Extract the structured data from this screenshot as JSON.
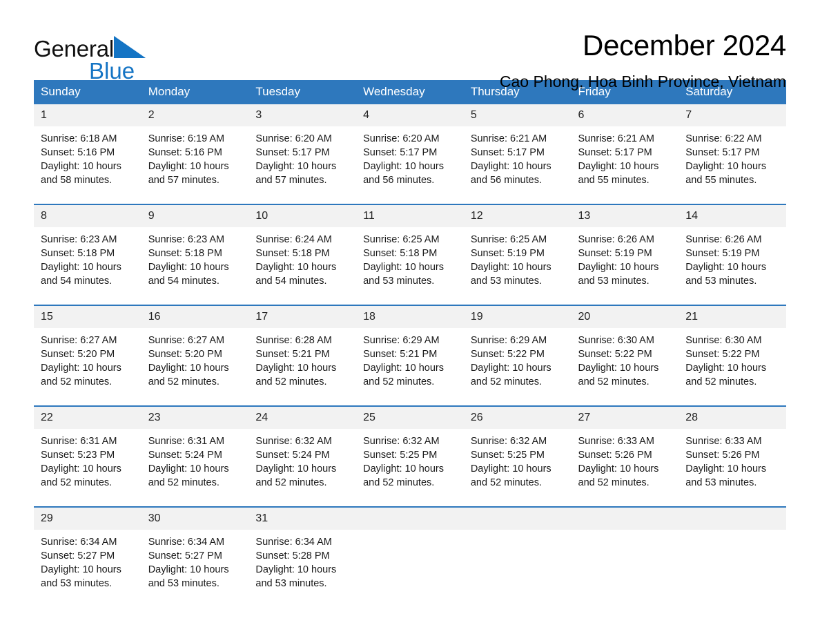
{
  "brand": {
    "word_general": "General",
    "word_blue": "Blue",
    "triangle_color": "#1474c4",
    "blue_text_color": "#1474c4"
  },
  "header": {
    "title": "December 2024",
    "subtitle": "Cao Phong, Hoa Binh Province, Vietnam"
  },
  "theme": {
    "header_blue": "#2e78bd",
    "daynum_gray": "#f2f2f2",
    "row_divider": "#2e78bd"
  },
  "weekdays": [
    "Sunday",
    "Monday",
    "Tuesday",
    "Wednesday",
    "Thursday",
    "Friday",
    "Saturday"
  ],
  "labels": {
    "sunrise_prefix": "Sunrise:",
    "sunset_prefix": "Sunset:",
    "daylight_prefix": "Daylight:"
  },
  "weeks": [
    [
      {
        "day": "1",
        "sunrise": "Sunrise: 6:18 AM",
        "sunset": "Sunset: 5:16 PM",
        "daylight_line1": "Daylight: 10 hours",
        "daylight_line2": "and 58 minutes."
      },
      {
        "day": "2",
        "sunrise": "Sunrise: 6:19 AM",
        "sunset": "Sunset: 5:16 PM",
        "daylight_line1": "Daylight: 10 hours",
        "daylight_line2": "and 57 minutes."
      },
      {
        "day": "3",
        "sunrise": "Sunrise: 6:20 AM",
        "sunset": "Sunset: 5:17 PM",
        "daylight_line1": "Daylight: 10 hours",
        "daylight_line2": "and 57 minutes."
      },
      {
        "day": "4",
        "sunrise": "Sunrise: 6:20 AM",
        "sunset": "Sunset: 5:17 PM",
        "daylight_line1": "Daylight: 10 hours",
        "daylight_line2": "and 56 minutes."
      },
      {
        "day": "5",
        "sunrise": "Sunrise: 6:21 AM",
        "sunset": "Sunset: 5:17 PM",
        "daylight_line1": "Daylight: 10 hours",
        "daylight_line2": "and 56 minutes."
      },
      {
        "day": "6",
        "sunrise": "Sunrise: 6:21 AM",
        "sunset": "Sunset: 5:17 PM",
        "daylight_line1": "Daylight: 10 hours",
        "daylight_line2": "and 55 minutes."
      },
      {
        "day": "7",
        "sunrise": "Sunrise: 6:22 AM",
        "sunset": "Sunset: 5:17 PM",
        "daylight_line1": "Daylight: 10 hours",
        "daylight_line2": "and 55 minutes."
      }
    ],
    [
      {
        "day": "8",
        "sunrise": "Sunrise: 6:23 AM",
        "sunset": "Sunset: 5:18 PM",
        "daylight_line1": "Daylight: 10 hours",
        "daylight_line2": "and 54 minutes."
      },
      {
        "day": "9",
        "sunrise": "Sunrise: 6:23 AM",
        "sunset": "Sunset: 5:18 PM",
        "daylight_line1": "Daylight: 10 hours",
        "daylight_line2": "and 54 minutes."
      },
      {
        "day": "10",
        "sunrise": "Sunrise: 6:24 AM",
        "sunset": "Sunset: 5:18 PM",
        "daylight_line1": "Daylight: 10 hours",
        "daylight_line2": "and 54 minutes."
      },
      {
        "day": "11",
        "sunrise": "Sunrise: 6:25 AM",
        "sunset": "Sunset: 5:18 PM",
        "daylight_line1": "Daylight: 10 hours",
        "daylight_line2": "and 53 minutes."
      },
      {
        "day": "12",
        "sunrise": "Sunrise: 6:25 AM",
        "sunset": "Sunset: 5:19 PM",
        "daylight_line1": "Daylight: 10 hours",
        "daylight_line2": "and 53 minutes."
      },
      {
        "day": "13",
        "sunrise": "Sunrise: 6:26 AM",
        "sunset": "Sunset: 5:19 PM",
        "daylight_line1": "Daylight: 10 hours",
        "daylight_line2": "and 53 minutes."
      },
      {
        "day": "14",
        "sunrise": "Sunrise: 6:26 AM",
        "sunset": "Sunset: 5:19 PM",
        "daylight_line1": "Daylight: 10 hours",
        "daylight_line2": "and 53 minutes."
      }
    ],
    [
      {
        "day": "15",
        "sunrise": "Sunrise: 6:27 AM",
        "sunset": "Sunset: 5:20 PM",
        "daylight_line1": "Daylight: 10 hours",
        "daylight_line2": "and 52 minutes."
      },
      {
        "day": "16",
        "sunrise": "Sunrise: 6:27 AM",
        "sunset": "Sunset: 5:20 PM",
        "daylight_line1": "Daylight: 10 hours",
        "daylight_line2": "and 52 minutes."
      },
      {
        "day": "17",
        "sunrise": "Sunrise: 6:28 AM",
        "sunset": "Sunset: 5:21 PM",
        "daylight_line1": "Daylight: 10 hours",
        "daylight_line2": "and 52 minutes."
      },
      {
        "day": "18",
        "sunrise": "Sunrise: 6:29 AM",
        "sunset": "Sunset: 5:21 PM",
        "daylight_line1": "Daylight: 10 hours",
        "daylight_line2": "and 52 minutes."
      },
      {
        "day": "19",
        "sunrise": "Sunrise: 6:29 AM",
        "sunset": "Sunset: 5:22 PM",
        "daylight_line1": "Daylight: 10 hours",
        "daylight_line2": "and 52 minutes."
      },
      {
        "day": "20",
        "sunrise": "Sunrise: 6:30 AM",
        "sunset": "Sunset: 5:22 PM",
        "daylight_line1": "Daylight: 10 hours",
        "daylight_line2": "and 52 minutes."
      },
      {
        "day": "21",
        "sunrise": "Sunrise: 6:30 AM",
        "sunset": "Sunset: 5:22 PM",
        "daylight_line1": "Daylight: 10 hours",
        "daylight_line2": "and 52 minutes."
      }
    ],
    [
      {
        "day": "22",
        "sunrise": "Sunrise: 6:31 AM",
        "sunset": "Sunset: 5:23 PM",
        "daylight_line1": "Daylight: 10 hours",
        "daylight_line2": "and 52 minutes."
      },
      {
        "day": "23",
        "sunrise": "Sunrise: 6:31 AM",
        "sunset": "Sunset: 5:24 PM",
        "daylight_line1": "Daylight: 10 hours",
        "daylight_line2": "and 52 minutes."
      },
      {
        "day": "24",
        "sunrise": "Sunrise: 6:32 AM",
        "sunset": "Sunset: 5:24 PM",
        "daylight_line1": "Daylight: 10 hours",
        "daylight_line2": "and 52 minutes."
      },
      {
        "day": "25",
        "sunrise": "Sunrise: 6:32 AM",
        "sunset": "Sunset: 5:25 PM",
        "daylight_line1": "Daylight: 10 hours",
        "daylight_line2": "and 52 minutes."
      },
      {
        "day": "26",
        "sunrise": "Sunrise: 6:32 AM",
        "sunset": "Sunset: 5:25 PM",
        "daylight_line1": "Daylight: 10 hours",
        "daylight_line2": "and 52 minutes."
      },
      {
        "day": "27",
        "sunrise": "Sunrise: 6:33 AM",
        "sunset": "Sunset: 5:26 PM",
        "daylight_line1": "Daylight: 10 hours",
        "daylight_line2": "and 52 minutes."
      },
      {
        "day": "28",
        "sunrise": "Sunrise: 6:33 AM",
        "sunset": "Sunset: 5:26 PM",
        "daylight_line1": "Daylight: 10 hours",
        "daylight_line2": "and 53 minutes."
      }
    ],
    [
      {
        "day": "29",
        "sunrise": "Sunrise: 6:34 AM",
        "sunset": "Sunset: 5:27 PM",
        "daylight_line1": "Daylight: 10 hours",
        "daylight_line2": "and 53 minutes."
      },
      {
        "day": "30",
        "sunrise": "Sunrise: 6:34 AM",
        "sunset": "Sunset: 5:27 PM",
        "daylight_line1": "Daylight: 10 hours",
        "daylight_line2": "and 53 minutes."
      },
      {
        "day": "31",
        "sunrise": "Sunrise: 6:34 AM",
        "sunset": "Sunset: 5:28 PM",
        "daylight_line1": "Daylight: 10 hours",
        "daylight_line2": "and 53 minutes."
      },
      {
        "day": "",
        "sunrise": "",
        "sunset": "",
        "daylight_line1": "",
        "daylight_line2": ""
      },
      {
        "day": "",
        "sunrise": "",
        "sunset": "",
        "daylight_line1": "",
        "daylight_line2": ""
      },
      {
        "day": "",
        "sunrise": "",
        "sunset": "",
        "daylight_line1": "",
        "daylight_line2": ""
      },
      {
        "day": "",
        "sunrise": "",
        "sunset": "",
        "daylight_line1": "",
        "daylight_line2": ""
      }
    ]
  ]
}
